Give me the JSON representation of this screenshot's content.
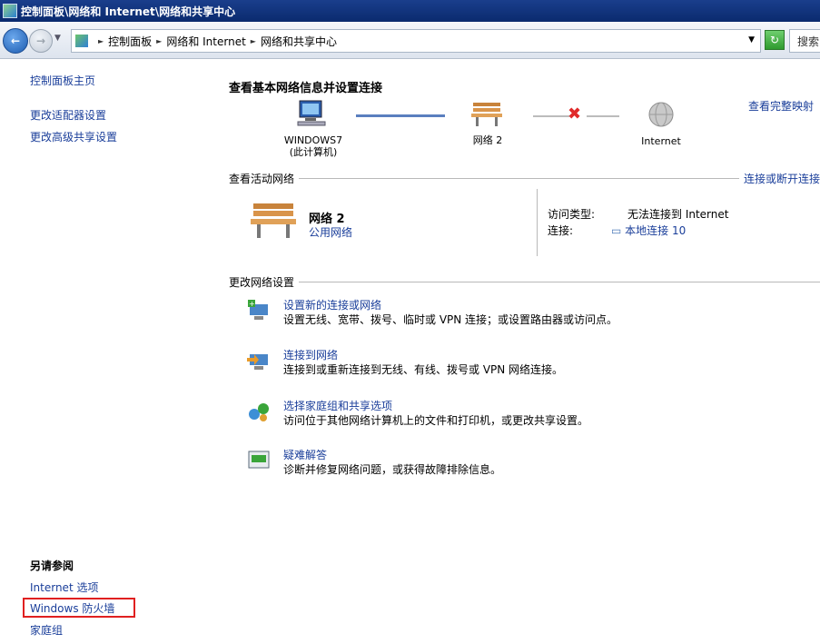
{
  "window": {
    "title": "控制面板\\网络和 Internet\\网络和共享中心"
  },
  "address": {
    "crumbs": [
      "控制面板",
      "网络和 Internet",
      "网络和共享中心"
    ],
    "search_placeholder": "搜索"
  },
  "left": {
    "links": [
      "控制面板主页",
      "更改适配器设置",
      "更改高级共享设置"
    ],
    "see_also_title": "另请参阅",
    "see_also": [
      "Internet 选项",
      "Windows 防火墙",
      "家庭组"
    ]
  },
  "main": {
    "heading": "查看基本网络信息并设置连接",
    "full_map_link": "查看完整映射",
    "map": {
      "computer_name": "WINDOWS7",
      "computer_sub": "(此计算机)",
      "network": "网络  2",
      "internet": "Internet"
    },
    "active_section": "查看活动网络",
    "connect_link": "连接或断开连接",
    "network_name": "网络  2",
    "network_type": "公用网络",
    "access_type_label": "访问类型:",
    "access_type_value": "无法连接到 Internet",
    "connection_label": "连接:",
    "connection_value": "本地连接 10",
    "change_section": "更改网络设置",
    "tasks": [
      {
        "title": "设置新的连接或网络",
        "desc": "设置无线、宽带、拨号、临时或 VPN 连接；或设置路由器或访问点。"
      },
      {
        "title": "连接到网络",
        "desc": "连接到或重新连接到无线、有线、拨号或 VPN 网络连接。"
      },
      {
        "title": "选择家庭组和共享选项",
        "desc": "访问位于其他网络计算机上的文件和打印机，或更改共享设置。"
      },
      {
        "title": "疑难解答",
        "desc": "诊断并修复网络问题，或获得故障排除信息。"
      }
    ]
  },
  "colors": {
    "link": "#1a3e9a",
    "highlight_box": "#e02020",
    "title_bar": "#0a2a6e"
  }
}
